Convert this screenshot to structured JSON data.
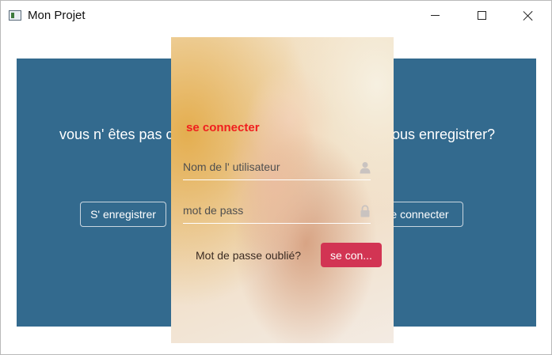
{
  "window": {
    "title": "Mon Projet"
  },
  "background_panel": {
    "question_left": "vous n' êtes pas c",
    "question_right": "ous enregistrer?",
    "register_button": "S' enregistrer",
    "connect_button": "e connecter"
  },
  "login_card": {
    "title": "se connecter",
    "username_placeholder": "Nom de l' utilisateur",
    "password_placeholder": "mot de pass",
    "forgot_link": "Mot de passe oublié?",
    "submit_button": "se con..."
  },
  "colors": {
    "panel_bg": "#336a8e",
    "title_red": "#f01e1e",
    "submit_bg": "#d23453"
  }
}
